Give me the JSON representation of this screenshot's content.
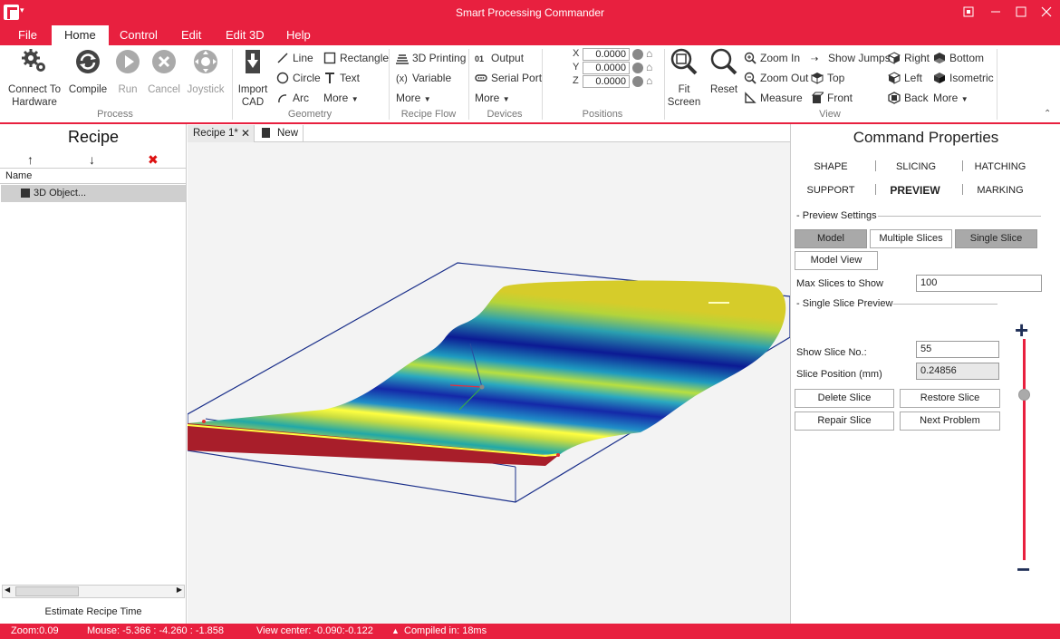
{
  "title_bar": {
    "title": "Smart Processing Commander",
    "caret": "▾"
  },
  "ribbon_tabs": [
    "File",
    "Home",
    "Control",
    "Edit",
    "Edit 3D",
    "Help"
  ],
  "ribbon": {
    "process": {
      "label": "Process",
      "connect": [
        "Connect To",
        "Hardware"
      ],
      "compile": "Compile",
      "run": "Run",
      "cancel": "Cancel",
      "joystick": "Joystick"
    },
    "geometry": {
      "label": "Geometry",
      "import": [
        "Import",
        "CAD"
      ],
      "line": "Line",
      "circle": "Circle",
      "arc": "Arc",
      "rectangle": "Rectangle",
      "text": "Text",
      "more": "More"
    },
    "recipe_flow": {
      "label": "Recipe Flow",
      "printing": "3D Printing",
      "variable": "Variable",
      "more": "More"
    },
    "devices": {
      "label": "Devices",
      "output": "Output",
      "serial": "Serial Port",
      "more": "More"
    },
    "positions": {
      "label": "Positions",
      "x_label": "X",
      "x_value": "0.0000",
      "y_label": "Y",
      "y_value": "0.0000",
      "z_label": "Z",
      "z_value": "0.0000"
    },
    "view": {
      "label": "View",
      "fit": [
        "Fit",
        "Screen"
      ],
      "reset": "Reset",
      "zoom_in": "Zoom In",
      "zoom_out": "Zoom Out",
      "measure": "Measure",
      "show_jumps": "Show Jumps",
      "top": "Top",
      "front": "Front",
      "right": "Right",
      "left": "Left",
      "back": "Back",
      "bottom": "Bottom",
      "isometric": "Isometric",
      "more": "More"
    }
  },
  "recipe_panel": {
    "title": "Recipe",
    "up_icon": "↑",
    "down_icon": "↓",
    "delete_icon": "✖",
    "column_name": "Name",
    "items": [
      "3D Object..."
    ],
    "footer": "Estimate Recipe Time"
  },
  "doc_tabs": {
    "recipe": "Recipe 1*",
    "new": "New"
  },
  "command_properties": {
    "title": "Command Properties",
    "tabs_row1": [
      "SHAPE",
      "SLICING",
      "HATCHING"
    ],
    "tabs_row2": [
      "SUPPORT",
      "PREVIEW",
      "MARKING"
    ],
    "preview_settings": "Preview Settings",
    "btn_model": "Model",
    "btn_multiple": "Multiple Slices",
    "btn_single": "Single Slice",
    "btn_model_view": "Model View",
    "max_slices_label": "Max Slices to Show",
    "max_slices_value": "100",
    "single_slice_preview": "Single Slice Preview",
    "show_slice_label": "Show Slice No.:",
    "show_slice_value": "55",
    "slice_pos_label": "Slice Position (mm)",
    "slice_pos_value": "0.24856",
    "delete_slice": "Delete Slice",
    "restore_slice": "Restore Slice",
    "repair_slice": "Repair Slice",
    "next_problem": "Next Problem",
    "slider_plus": "+",
    "slider_minus": "−",
    "slider_level": 0.75
  },
  "status_bar": {
    "zoom": "Zoom:0.09",
    "mouse": "Mouse: -5.366 : -4.260 : -1.858",
    "view_center": "View center: -0.090:-0.122",
    "compiled": "Compiled in: 18ms",
    "compiled_icon": "▲"
  },
  "colors": {
    "accent": "#e8203f",
    "slider": "#1f2f57"
  }
}
